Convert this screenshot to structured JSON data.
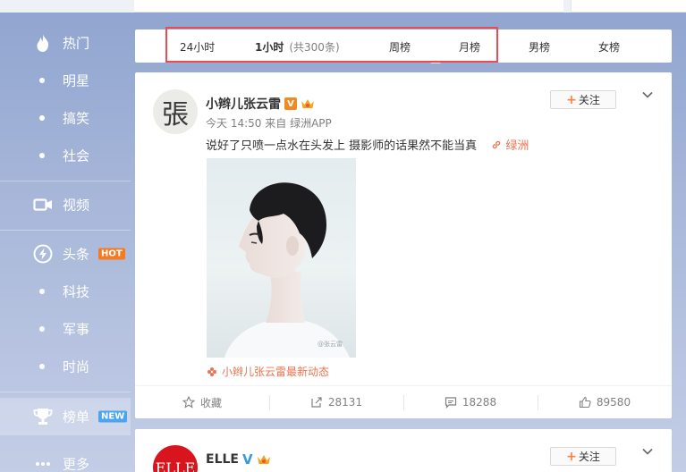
{
  "sidebar": {
    "items": [
      {
        "label": "热门",
        "icon": "fire-icon"
      },
      {
        "label": "明星"
      },
      {
        "label": "搞笑"
      },
      {
        "label": "社会"
      },
      {
        "label": "视频",
        "icon": "video-icon"
      },
      {
        "label": "头条",
        "icon": "lightning-icon",
        "badge": "HOT"
      },
      {
        "label": "科技"
      },
      {
        "label": "军事"
      },
      {
        "label": "时尚"
      },
      {
        "label": "榜单",
        "icon": "trophy-icon",
        "badge": "NEW"
      },
      {
        "label": "更多",
        "icon": "more-icon"
      }
    ]
  },
  "tabs": {
    "items": [
      {
        "label": "24小时"
      },
      {
        "label": "1小时",
        "count": "(共300条)"
      },
      {
        "label": "周榜"
      },
      {
        "label": "月榜"
      },
      {
        "label": "男榜"
      },
      {
        "label": "女榜"
      }
    ],
    "active": "1小时"
  },
  "post": {
    "author": "小辫儿张云雷",
    "avatar_char": "張",
    "verified_badge": "V",
    "meta_time": "今天 14:50",
    "meta_source_prefix": "来自",
    "meta_source": "绿洲APP",
    "text": "说好了只喷一点水在头发上 摄影师的话果然不能当真",
    "link_label": "绿洲",
    "follow_label": "关注",
    "image_watermark": "@张云雷",
    "caption": "小辫儿张云雷最新动态",
    "actions": {
      "favorite": "收藏",
      "repost": "28131",
      "comment": "18288",
      "like": "89580"
    }
  },
  "post2": {
    "author": "ELLE",
    "avatar_text": "ELLE",
    "follow_label": "关注"
  },
  "colors": {
    "accent": "#eb7350",
    "hot": "#f57a22",
    "new": "#4aa4ee",
    "highlight": "#e84c56"
  }
}
